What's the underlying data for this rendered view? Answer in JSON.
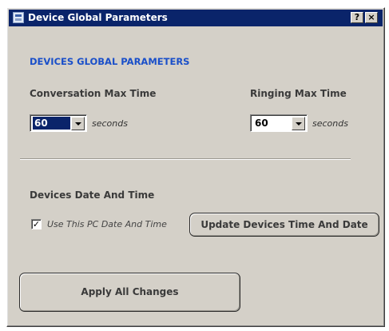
{
  "window": {
    "title": "Device Global Parameters",
    "help_label": "?",
    "close_label": "×"
  },
  "section": {
    "title": "DEVICES GLOBAL PARAMETERS"
  },
  "conversation": {
    "label": "Conversation Max Time",
    "value": "60",
    "unit": "seconds"
  },
  "ringing": {
    "label": "Ringing Max Time",
    "value": "60",
    "unit": "seconds"
  },
  "datetime": {
    "title": "Devices Date And Time",
    "checkbox_label": "Use This PC Date And Time",
    "checkbox_checked": true,
    "check_mark": "✓",
    "update_button": "Update Devices Time And Date"
  },
  "apply_button": "Apply All Changes",
  "colors": {
    "titlebar": "#0a246a",
    "window_bg": "#d4d0c8",
    "section_title": "#1a4fc9"
  }
}
